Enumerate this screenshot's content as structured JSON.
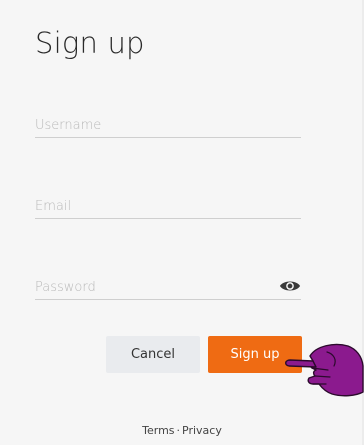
{
  "form": {
    "title": "Sign up",
    "username_placeholder": "Username",
    "email_placeholder": "Email",
    "password_placeholder": "Password",
    "username_value": "",
    "email_value": "",
    "password_value": ""
  },
  "buttons": {
    "cancel_label": "Cancel",
    "signup_label": "Sign up"
  },
  "icons": {
    "password_toggle": "eye-icon",
    "pointer": "hand-pointer-icon"
  },
  "footer": {
    "terms_label": "Terms",
    "separator": "·",
    "privacy_label": "Privacy"
  },
  "colors": {
    "primary": "#ef6b13",
    "secondary": "#e9ebee",
    "hand": "#8b1a8e"
  }
}
